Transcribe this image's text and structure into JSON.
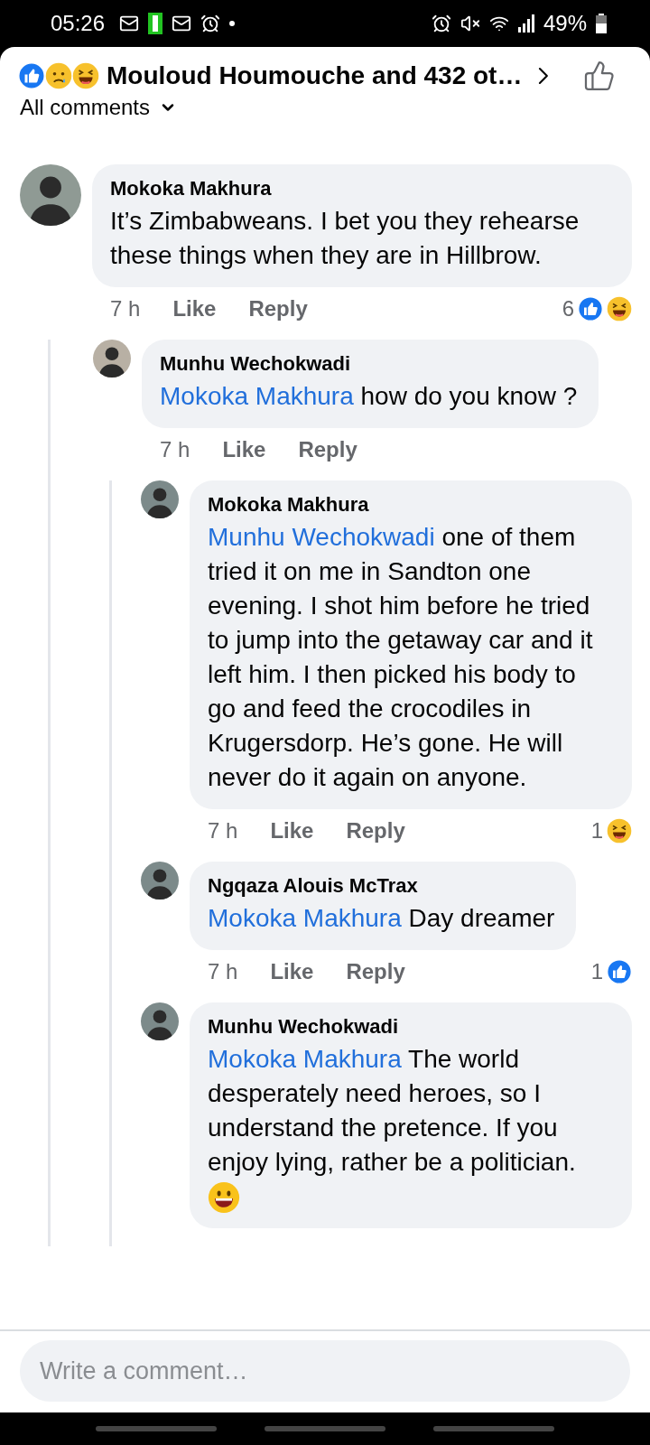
{
  "status_bar": {
    "time": "05:26",
    "battery": "49%"
  },
  "header": {
    "reactions": [
      {
        "kind": "like"
      },
      {
        "kind": "sad"
      },
      {
        "kind": "haha"
      }
    ],
    "title": "Mouloud Houmouche and 432 ot…"
  },
  "filter": {
    "label": "All comments"
  },
  "comments": [
    {
      "author": "Mokoka Makhura",
      "text": "It’s Zimbabweans. I bet you they rehearse these things when they are in Hillbrow.",
      "time": "7 h",
      "like": "Like",
      "reply": "Reply",
      "reaction_count": "6",
      "reactions": [
        {
          "kind": "like"
        },
        {
          "kind": "haha"
        }
      ],
      "children": [
        {
          "author": "Munhu Wechokwadi",
          "mention": "Mokoka Makhura",
          "text": "how do you know ?",
          "time": "7 h",
          "like": "Like",
          "reply": "Reply",
          "children": [
            {
              "author": "Mokoka Makhura",
              "mention": "Munhu Wechokwadi",
              "text": "one of them tried it on me in Sandton one evening. I shot him before he tried to jump into the getaway car and it left him. I then picked his body to go and feed the crocodiles in Krugersdorp. He’s gone. He will never do it again on anyone.",
              "time": "7 h",
              "like": "Like",
              "reply": "Reply",
              "reaction_count": "1",
              "reactions": [
                {
                  "kind": "haha"
                }
              ]
            },
            {
              "author": "Ngqaza Alouis McTrax",
              "mention": "Mokoka Makhura",
              "text": "Day dreamer",
              "time": "7 h",
              "like": "Like",
              "reply": "Reply",
              "reaction_count": "1",
              "reactions": [
                {
                  "kind": "like"
                }
              ]
            },
            {
              "author": "Munhu Wechokwadi",
              "mention": "Mokoka Makhura",
              "text": "The world desperately need heroes, so I understand the pretence. If you enjoy lying, rather be a politician.",
              "sticker": {
                "kind": "grinning"
              }
            }
          ]
        }
      ]
    }
  ],
  "composer": {
    "placeholder": "Write a comment…"
  }
}
